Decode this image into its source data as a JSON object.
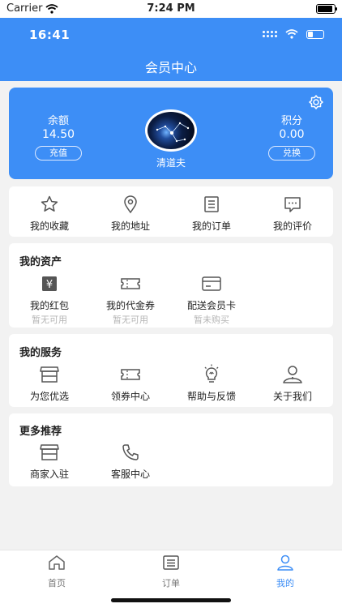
{
  "status_bar": {
    "carrier": "Carrier",
    "time": "7:24 PM"
  },
  "inner_status": {
    "time": "16:41"
  },
  "header": {
    "title": "会员中心"
  },
  "member_card": {
    "balance_label": "余额",
    "balance_value": "14.50",
    "recharge_button": "充值",
    "points_label": "积分",
    "points_value": "0.00",
    "exchange_button": "兑换",
    "username": "清道夫"
  },
  "quick_links": [
    {
      "label": "我的收藏",
      "icon": "star-icon"
    },
    {
      "label": "我的地址",
      "icon": "location-pin-icon"
    },
    {
      "label": "我的订单",
      "icon": "order-list-icon"
    },
    {
      "label": "我的评价",
      "icon": "comment-icon"
    }
  ],
  "assets": {
    "title": "我的资产",
    "items": [
      {
        "label": "我的红包",
        "sub": "暂无可用",
        "icon": "red-packet-icon"
      },
      {
        "label": "我的代金券",
        "sub": "暂无可用",
        "icon": "voucher-icon"
      },
      {
        "label": "配送会员卡",
        "sub": "暂未购买",
        "icon": "member-card-icon"
      }
    ]
  },
  "services": {
    "title": "我的服务",
    "items": [
      {
        "label": "为您优选",
        "icon": "store-icon"
      },
      {
        "label": "领券中心",
        "icon": "coupon-icon"
      },
      {
        "label": "帮助与反馈",
        "icon": "lightbulb-icon"
      },
      {
        "label": "关于我们",
        "icon": "person-icon"
      }
    ]
  },
  "more": {
    "title": "更多推荐",
    "items": [
      {
        "label": "商家入驻",
        "icon": "shop-icon"
      },
      {
        "label": "客服中心",
        "icon": "phone-icon"
      }
    ]
  },
  "tabbar": [
    {
      "label": "首页",
      "icon": "home-icon"
    },
    {
      "label": "订单",
      "icon": "orders-icon"
    },
    {
      "label": "我的",
      "icon": "profile-icon",
      "active": true
    }
  ],
  "colors": {
    "primary": "#3d8ef6",
    "background": "#f2f2f2",
    "muted_text": "#b5b5b5"
  }
}
